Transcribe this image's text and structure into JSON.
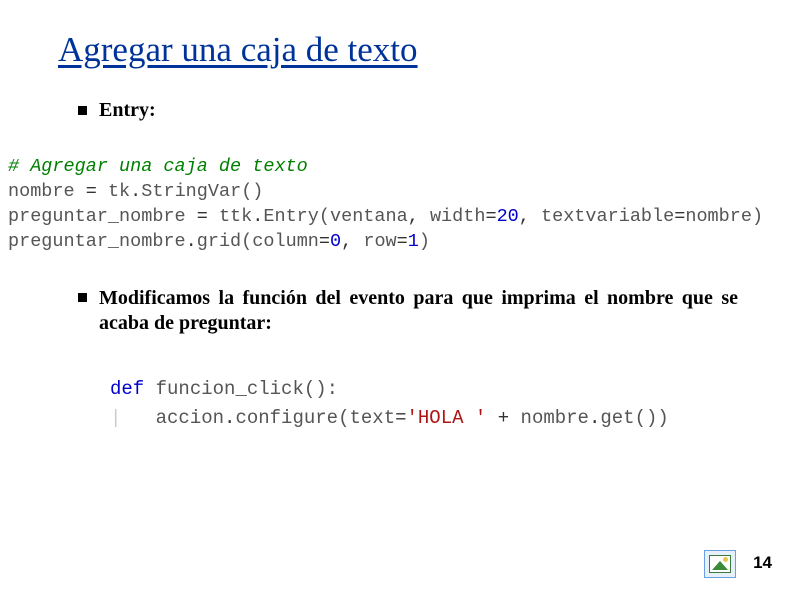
{
  "title": "Agregar una caja de texto",
  "bullets": {
    "b1": "Entry:",
    "b2": "Modificamos la función del evento para que imprima el nombre que se acaba de preguntar:"
  },
  "code1": {
    "l1_comment": "# Agregar una caja de texto",
    "l2_a": "nombre",
    "l2_eq": " = ",
    "l2_b": "tk",
    "l2_dot1": ".",
    "l2_c": "StringVar",
    "l2_p": "()",
    "l3_a": "preguntar_nombre",
    "l3_eq": " = ",
    "l3_b": "ttk",
    "l3_dot1": ".",
    "l3_c": "Entry",
    "l3_po": "(",
    "l3_d": "ventana",
    "l3_com1": ", ",
    "l3_e": "width",
    "l3_eq2": "=",
    "l3_num": "20",
    "l3_com2": ", ",
    "l3_f": "textvariable",
    "l3_eq3": "=",
    "l3_g": "nombre",
    "l3_pc": ")",
    "l4_a": "preguntar_nombre",
    "l4_dot": ".",
    "l4_b": "grid",
    "l4_po": "(",
    "l4_c": "column",
    "l4_eq1": "=",
    "l4_n1": "0",
    "l4_com": ", ",
    "l4_d": "row",
    "l4_eq2": "=",
    "l4_n2": "1",
    "l4_pc": ")"
  },
  "code2": {
    "l1_def": "def",
    "l1_sp": " ",
    "l1_name": "funcion_click",
    "l1_p": "():",
    "l2_bar": "|",
    "l2_ind": "   ",
    "l2_a": "accion",
    "l2_dot": ".",
    "l2_b": "configure",
    "l2_po": "(",
    "l2_c": "text",
    "l2_eq": "=",
    "l2_str": "'HOLA '",
    "l2_plus": " + ",
    "l2_d": "nombre",
    "l2_dot2": ".",
    "l2_e": "get",
    "l2_p2": "()",
    "l2_pc": ")"
  },
  "page_number": "14"
}
